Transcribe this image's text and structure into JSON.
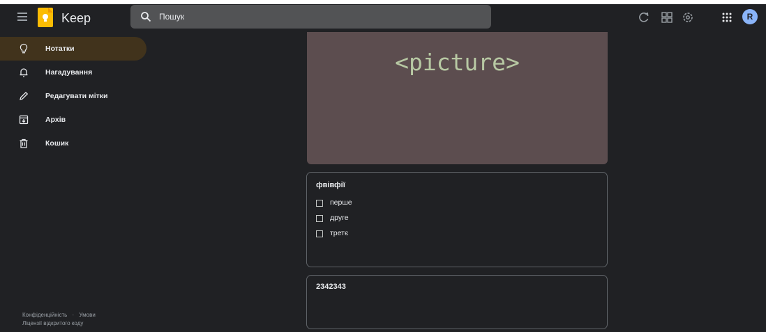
{
  "app": {
    "brand": "Keep"
  },
  "search": {
    "placeholder": "Пошук"
  },
  "header": {
    "avatar_letter": "R"
  },
  "sidebar": {
    "items": [
      {
        "label": "Нотатки",
        "icon": "lightbulb-icon",
        "active": true
      },
      {
        "label": "Нагадування",
        "icon": "bell-icon",
        "active": false
      },
      {
        "label": "Редагувати мітки",
        "icon": "pencil-icon",
        "active": false
      },
      {
        "label": "Архів",
        "icon": "archive-icon",
        "active": false
      },
      {
        "label": "Кошик",
        "icon": "trash-icon",
        "active": false
      }
    ],
    "footer": {
      "privacy": "Конфіденційність",
      "separator": "·",
      "terms": "Умови",
      "licenses": "Ліцензії відкритого коду"
    }
  },
  "notes": [
    {
      "type": "image",
      "alt": "<picture>"
    },
    {
      "type": "checklist",
      "title": "фвівфії",
      "items": [
        {
          "label": "перше",
          "checked": false
        },
        {
          "label": "друге",
          "checked": false
        },
        {
          "label": "третє",
          "checked": false
        }
      ]
    },
    {
      "type": "text",
      "body": "2342343"
    }
  ],
  "colors": {
    "background": "#202124",
    "active_nav": "#41331c",
    "search_bg": "#525355",
    "image_bg": "#5c4d4f",
    "avatar": "#8ab4f8",
    "logo": "#fbbc04"
  }
}
